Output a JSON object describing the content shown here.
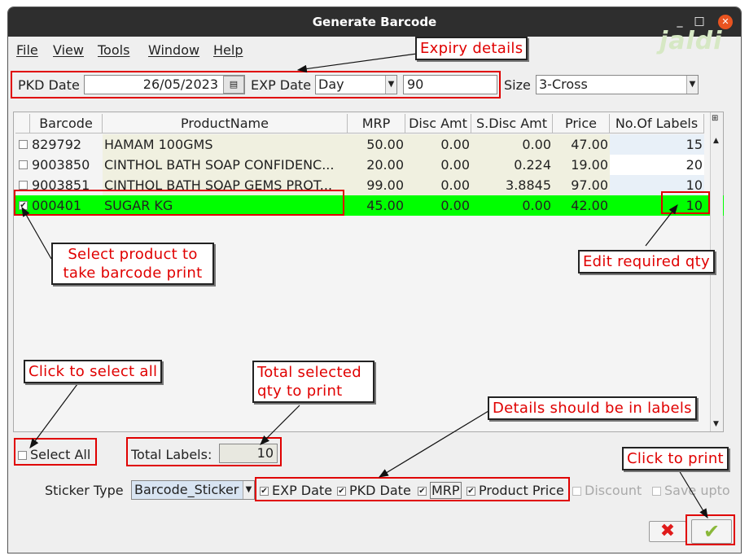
{
  "window": {
    "title": "Generate Barcode"
  },
  "menu": [
    "File",
    "View",
    "Tools",
    "Window",
    "Help"
  ],
  "watermark": "jaldi",
  "filters": {
    "pkd_label": "PKD Date",
    "pkd_value": "26/05/2023",
    "exp_label": "EXP Date",
    "exp_unit": "Day",
    "exp_value": "90",
    "size_label": "Size",
    "size_value": "3-Cross"
  },
  "table": {
    "columns": [
      "Barcode",
      "ProductName",
      "MRP",
      "Disc Amt",
      "S.Disc Amt",
      "Price",
      "No.Of Labels"
    ],
    "rows": [
      {
        "checked": false,
        "barcode": "829792",
        "name": "HAMAM 100GMS",
        "mrp": "50.00",
        "disc": "0.00",
        "sdisc": "0.00",
        "price": "47.00",
        "labels": "15"
      },
      {
        "checked": false,
        "barcode": "9003850",
        "name": "CINTHOL BATH SOAP CONFIDENC...",
        "mrp": "20.00",
        "disc": "0.00",
        "sdisc": "0.224",
        "price": "19.00",
        "labels": "20"
      },
      {
        "checked": false,
        "barcode": "9003851",
        "name": "CINTHOL BATH SOAP GEMS PROT...",
        "mrp": "99.00",
        "disc": "0.00",
        "sdisc": "3.8845",
        "price": "97.00",
        "labels": "10"
      },
      {
        "checked": true,
        "barcode": "000401",
        "name": "SUGAR KG",
        "mrp": "45.00",
        "disc": "0.00",
        "sdisc": "0.00",
        "price": "42.00",
        "labels": "10"
      }
    ]
  },
  "footer": {
    "select_all": "Select All",
    "total_label": "Total Labels:",
    "total_value": "10",
    "sticker_label": "Sticker Type",
    "sticker_value": "Barcode_Sticker",
    "options": [
      {
        "label": "EXP Date",
        "checked": true
      },
      {
        "label": "PKD Date",
        "checked": true
      },
      {
        "label": "MRP",
        "checked": true
      },
      {
        "label": "Product Price",
        "checked": true
      },
      {
        "label": "Discount",
        "checked": false
      },
      {
        "label": "Save upto",
        "checked": false
      }
    ]
  },
  "annotations": {
    "expiry": "Expiry details",
    "select_product": "Select product to take barcode print",
    "edit_qty": "Edit required qty",
    "click_select_all": "Click to select all",
    "total_selected": "Total selected qty to print",
    "details_labels": "Details should be in labels",
    "click_print": "Click to print"
  },
  "colors": {
    "selected_row": "#00ff00",
    "annotation": "#e00000",
    "titlebar": "#2e2e2e",
    "close_button": "#e95420"
  }
}
